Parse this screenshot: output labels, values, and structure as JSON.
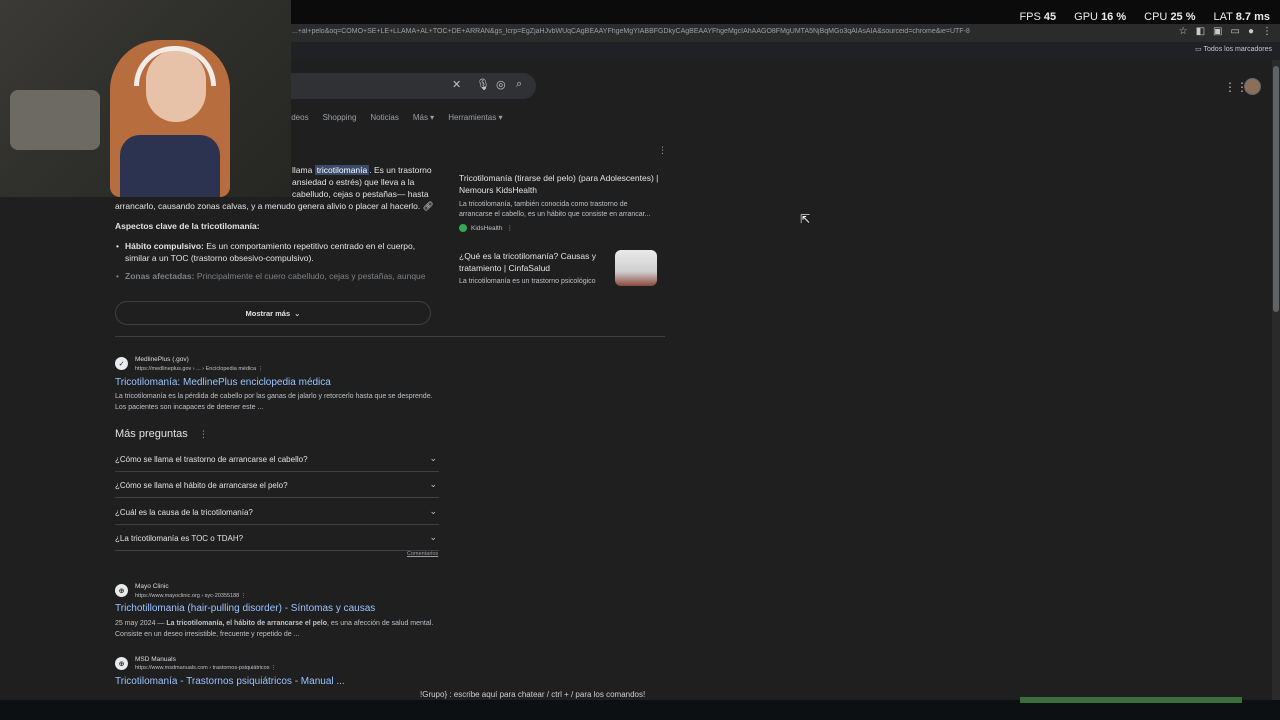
{
  "stats": {
    "fps_label": "FPS",
    "fps_value": "45",
    "gpu_label": "GPU",
    "gpu_value": "16 %",
    "cpu_label": "CPU",
    "cpu_value": "25 %",
    "lat_label": "LAT",
    "lat_value": "8.7 ms"
  },
  "browser": {
    "url": "...+al+pelo&oq=COMO+SE+LE+LLAMA+AL+TOC+DE+ARRAN&gs_lcrp=EgZjaHJvbWUqCAgBEAAYFhgeMgYIABBFGDkyCAgBEAAYFhgeMgcIAhAAGO8FMgUMTA5NjBqMGo3qAIAsAIA&sourceid=chrome&ie=UTF-8",
    "bookmarks_all": "Todos los marcadores"
  },
  "tabs": [
    "ídeos",
    "Shopping",
    "Noticias",
    "Más ▾",
    "Herramientas ▾"
  ],
  "ai_overview": {
    "line1_pre": "llama",
    "line1_hl": "tricotilomanía",
    "line1_post": ". Es un trastorno",
    "line2": "ansiedad o estrés) que lleva a la",
    "line3": "cabelludo, cejas o pestañas— hasta",
    "line4": "arrancarlo, causando zonas calvas, y a menudo genera alivio o placer al hacerlo.",
    "heading": "Aspectos clave de la tricotilomanía:",
    "bullet1_bold": "Hábito compulsivo:",
    "bullet1_text": " Es un comportamiento repetitivo centrado en el cuerpo, similar a un TOC (trastorno obsesivo-compulsivo).",
    "bullet2_bold": "Zonas afectadas:",
    "bullet2_text": " Principalmente el cuero cabelludo, cejas y pestañas, aunque",
    "show_more": "Mostrar más"
  },
  "side_cards": [
    {
      "title": "Tricotilomanía (tirarse del pelo) (para Adolescentes) | Nemours KidsHealth",
      "snippet": "La tricotilomanía, también conocida como trastorno de arrancarse el cabello, es un hábito que consiste en arrancar...",
      "source": "KidsHealth"
    },
    {
      "title": "¿Qué es la tricotilomanía? Causas y tratamiento | CinfaSalud",
      "snippet": "La tricotilomanía es un trastorno psicológico"
    }
  ],
  "results": [
    {
      "site": "MedlinePlus (.gov)",
      "url": "https://medlineplus.gov › ... › Enciclopedia médica",
      "title": "Tricotilomanía: MedlinePlus enciclopedia médica",
      "snippet": "La tricotilomanía es la pérdida de cabello por las ganas de jalarlo y retorcerlo hasta que se desprende. Los pacientes son incapaces de detener este ..."
    },
    {
      "site": "Mayo Clinic",
      "url": "https://www.mayoclinic.org › syc-20355188",
      "title": "Trichotillomania (hair-pulling disorder) - Síntomas y causas",
      "date": "25 may 2024 —",
      "snippet_bold": " La tricotilomanía, el hábito de arrancarse el pelo",
      "snippet": ", es una afección de salud mental. Consiste en un deseo irresistible, frecuente y repetido de ..."
    },
    {
      "site": "MSD Manuals",
      "url": "https://www.msdmanuals.com › trastornos-psiquiátricos",
      "title": "Tricotilomanía - Trastornos psiquiátricos - Manual ..."
    }
  ],
  "paa": {
    "title": "Más preguntas",
    "questions": [
      "¿Cómo se llama el trastorno de arrancarse el cabello?",
      "¿Cómo se llama el hábito de arrancarse el pelo?",
      "¿Cuál es la causa de la tricotilomanía?",
      "¿La tricotilomanía es TOC o TDAH?"
    ],
    "feedback": "Comentarios"
  },
  "chat_overlay": "!Grupo} : escribe aquí para chatear / ctrl + / para los comandos!"
}
